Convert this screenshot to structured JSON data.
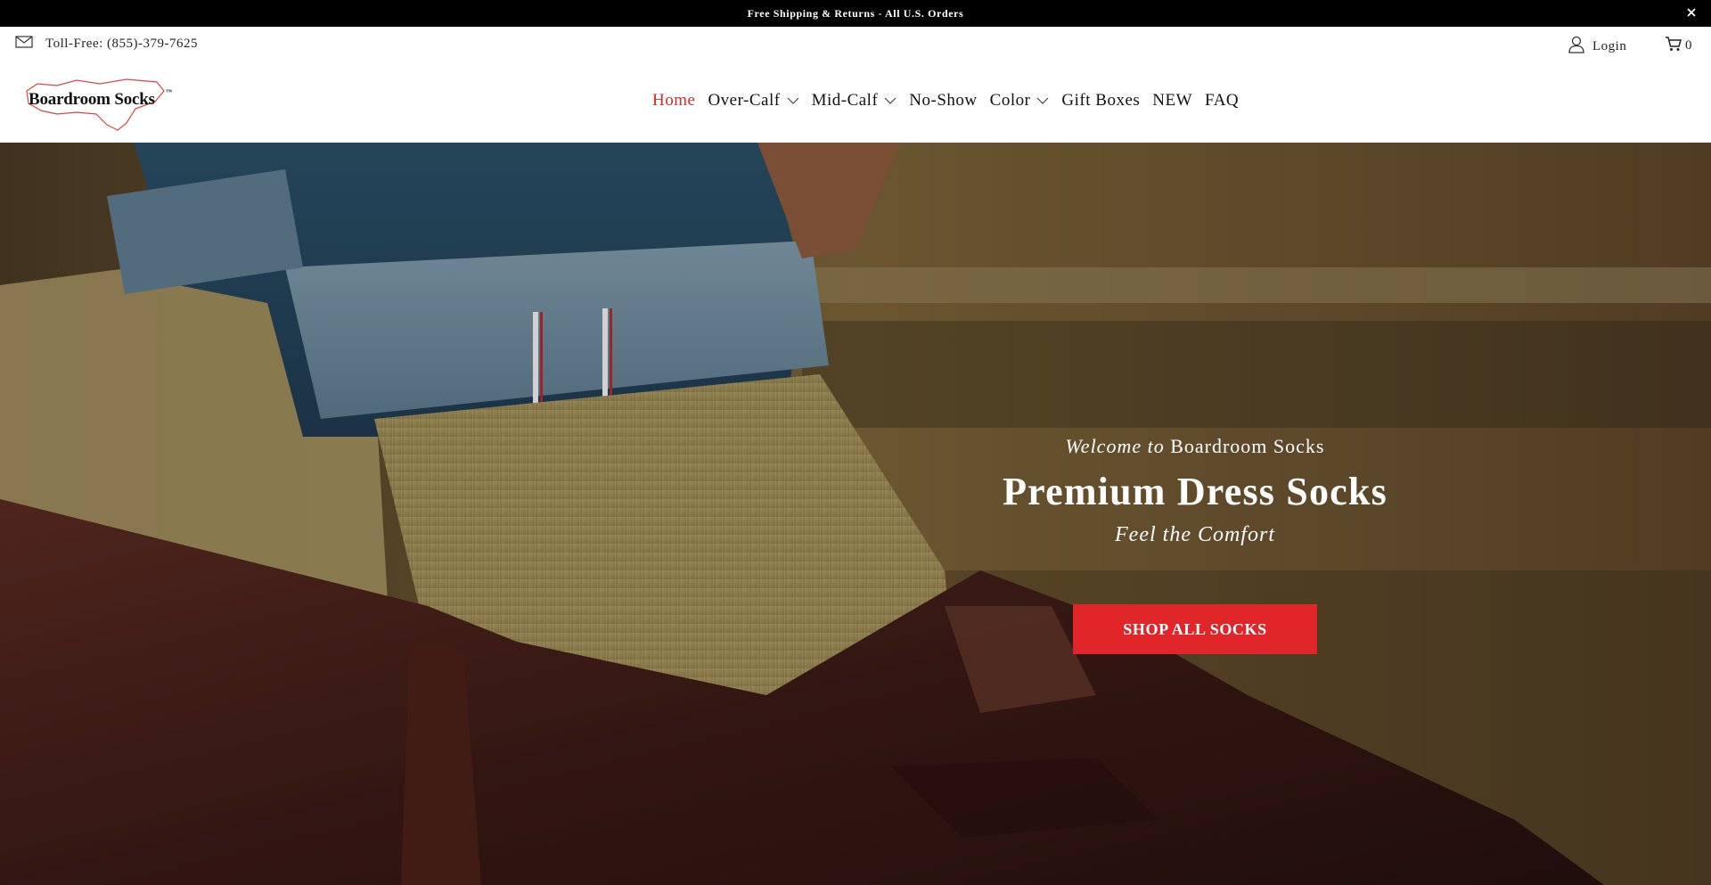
{
  "announcement": {
    "text": "Free Shipping & Returns - All U.S. Orders",
    "close_icon": "close-icon"
  },
  "utility": {
    "phone": "Toll-Free: (855)-379-7625",
    "phone_icon": "envelope-icon",
    "login_label": "Login",
    "login_icon": "user-icon",
    "cart_count": "0",
    "cart_icon": "cart-icon"
  },
  "header": {
    "logo_text": "Boardroom Socks",
    "logo_tm": "™",
    "nav": [
      {
        "label": "Home",
        "active": true,
        "dropdown": false
      },
      {
        "label": "Over-Calf",
        "active": false,
        "dropdown": true
      },
      {
        "label": "Mid-Calf",
        "active": false,
        "dropdown": true
      },
      {
        "label": "No-Show",
        "active": false,
        "dropdown": false
      },
      {
        "label": "Color",
        "active": false,
        "dropdown": true
      },
      {
        "label": "Gift Boxes",
        "active": false,
        "dropdown": false
      },
      {
        "label": "NEW",
        "active": false,
        "dropdown": false
      },
      {
        "label": "FAQ",
        "active": false,
        "dropdown": false
      }
    ]
  },
  "hero": {
    "welcome_italic": "Welcome to",
    "welcome_brand": "Boardroom Socks",
    "headline": "Premium Dress Socks",
    "subheadline": "Feel the Comfort",
    "cta_label": "SHOP ALL SOCKS"
  },
  "colors": {
    "accent": "#e1262a",
    "nav_active": "#d42a2a",
    "announcement_bg": "#000000"
  }
}
